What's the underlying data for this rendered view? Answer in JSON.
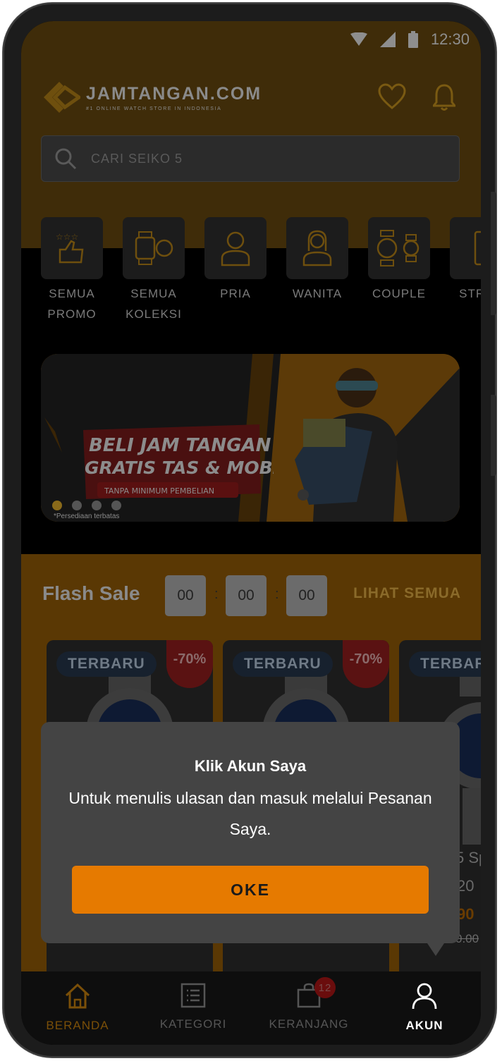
{
  "status_bar": {
    "time": "12:30",
    "icons": [
      "wifi-icon",
      "signal-icon",
      "battery-icon"
    ]
  },
  "header": {
    "logo_title": "JAMTANGAN.COM",
    "logo_subtitle": "#1 ONLINE WATCH STORE IN INDONESIA",
    "icons": [
      "heart-icon",
      "bell-icon"
    ]
  },
  "search": {
    "placeholder": "CARI SEIKO 5"
  },
  "categories": [
    {
      "line1": "SEMUA",
      "line2": "PROMO",
      "icon": "promo-icon"
    },
    {
      "line1": "SEMUA",
      "line2": "KOLEKSI",
      "icon": "watches-icon"
    },
    {
      "line1": "PRIA",
      "line2": "",
      "icon": "man-icon"
    },
    {
      "line1": "WANITA",
      "line2": "",
      "icon": "woman-icon"
    },
    {
      "line1": "COUPLE",
      "line2": "",
      "icon": "couple-watch-icon"
    },
    {
      "line1": "STRAP",
      "line2": "",
      "icon": "strap-icon"
    }
  ],
  "banner": {
    "headline_1": "BELI JAM TANGAN",
    "headline_2": "GRATIS TAS & MOBIL",
    "ribbon": "TANPA MINIMUM PEMBELIAN",
    "footnote": "*Persediaan terbatas",
    "slide_count": 4,
    "active_slide": 1
  },
  "flash_sale": {
    "title": "Flash Sale",
    "timer": {
      "hours": "00",
      "minutes": "00",
      "seconds": "00",
      "separator": ":"
    },
    "see_all": "LIHAT SEMUA",
    "products": [
      {
        "badge": "TERBARU",
        "discount": "-70%"
      },
      {
        "badge": "TERBARU",
        "discount": "-70%"
      },
      {
        "badge": "TERBARU",
        "name_fragment": "5 Sp",
        "year_fragment": "20",
        "price_fragment": "90",
        "old_price_fragment": "0.00"
      }
    ]
  },
  "modal": {
    "title": "Klik Akun Saya",
    "message": "Untuk menulis ulasan dan masuk melalui Pesanan Saya.",
    "button": "OKE"
  },
  "bottom_nav": {
    "items": [
      {
        "label": "BERANDA",
        "icon": "home-icon",
        "active": true
      },
      {
        "label": "KATEGORI",
        "icon": "list-icon"
      },
      {
        "label": "KERANJANG",
        "icon": "bag-icon",
        "badge": "12"
      },
      {
        "label": "AKUN",
        "icon": "user-icon"
      }
    ]
  },
  "colors": {
    "accent": "#e67a00",
    "modal_bg": "#444444",
    "badge_red": "#c0201f"
  }
}
